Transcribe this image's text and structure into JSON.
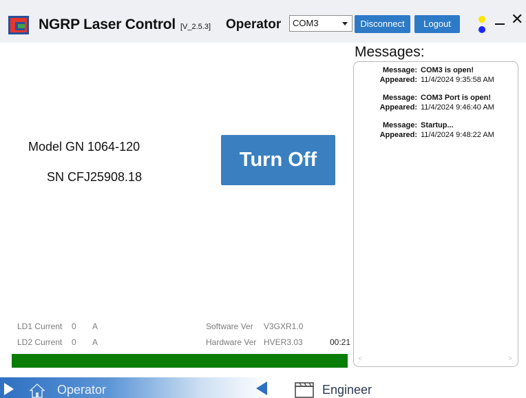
{
  "header": {
    "title": "NGRP Laser Control",
    "version": "[V_2.5.3]",
    "role": "Operator",
    "port": {
      "selected": "COM3"
    },
    "disconnect_label": "Disconnect",
    "logout_label": "Logout",
    "close_glyph": "✕",
    "colors": {
      "accent": "#2d7ac7",
      "status_top": "#ffe600",
      "status_bottom": "#1b26ff"
    }
  },
  "device": {
    "model": "Model GN 1064-120",
    "serial": "SN CFJ25908.18",
    "turn_off_label": "Turn Off"
  },
  "readouts": {
    "ld1_label": "LD1 Current",
    "ld1_value": "0",
    "ld1_unit": "A",
    "ld2_label": "LD2 Current",
    "ld2_value": "0",
    "ld2_unit": "A",
    "sw_label": "Software Ver",
    "sw_value": "V3GXR1.0",
    "hw_label": "Hardware Ver",
    "hw_value": "HVER3.03",
    "timer": "00:21"
  },
  "progress": {
    "fraction": 1.0,
    "color": "#0a7d07"
  },
  "messages": {
    "title": "Messages:",
    "message_key": "Message:",
    "appeared_key": "Appeared:",
    "items": [
      {
        "message": "COM3 is open!",
        "appeared": "11/4/2024 9:35:58 AM"
      },
      {
        "message": "COM3 Port is open!",
        "appeared": "11/4/2024 9:46:40 AM"
      },
      {
        "message": "Startup...",
        "appeared": "11/4/2024 9:48:22 AM"
      }
    ],
    "scroll_left": "<",
    "scroll_right": ">"
  },
  "nav": {
    "operator_label": "Operator",
    "engineer_label": "Engineer"
  }
}
